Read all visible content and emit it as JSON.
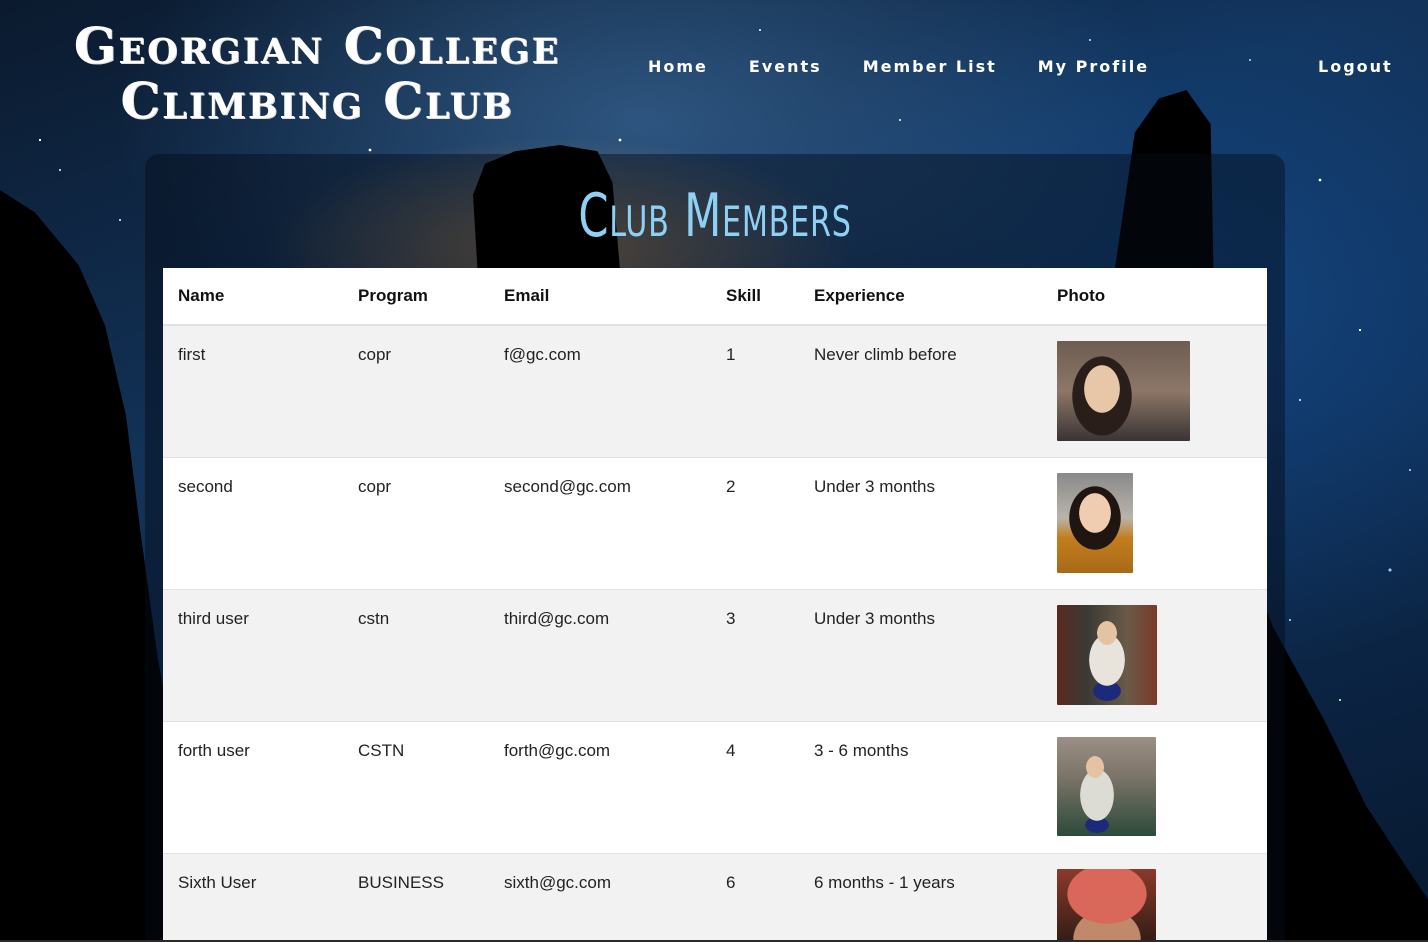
{
  "header": {
    "title_line1": "Georgian College",
    "title_line2": "Climbing Club"
  },
  "nav": {
    "items": [
      {
        "label": "Home"
      },
      {
        "label": "Events"
      },
      {
        "label": "Member List"
      },
      {
        "label": "My Profile"
      }
    ],
    "logout_label": "Logout"
  },
  "main": {
    "heading": "Club Members",
    "table": {
      "columns": [
        "Name",
        "Program",
        "Email",
        "Skill",
        "Experience",
        "Photo"
      ],
      "rows": [
        {
          "name": "first",
          "program": "copr",
          "email": "f@gc.com",
          "skill": "1",
          "experience": "Never climb before",
          "photo": "member-photo"
        },
        {
          "name": "second",
          "program": "copr",
          "email": "second@gc.com",
          "skill": "2",
          "experience": "Under 3 months",
          "photo": "member-photo"
        },
        {
          "name": "third user",
          "program": "cstn",
          "email": "third@gc.com",
          "skill": "3",
          "experience": "Under 3 months",
          "photo": "member-photo"
        },
        {
          "name": "forth user",
          "program": "CSTN",
          "email": "forth@gc.com",
          "skill": "4",
          "experience": "3 - 6 months",
          "photo": "member-photo"
        },
        {
          "name": "Sixth User",
          "program": "BUSINESS",
          "email": "sixth@gc.com",
          "skill": "6",
          "experience": "6 months - 1 years",
          "photo": "member-photo"
        }
      ]
    }
  },
  "colors": {
    "heading": "#8fd0f5",
    "background_sky": "#123258",
    "table_stripe": "#f2f2f2"
  }
}
